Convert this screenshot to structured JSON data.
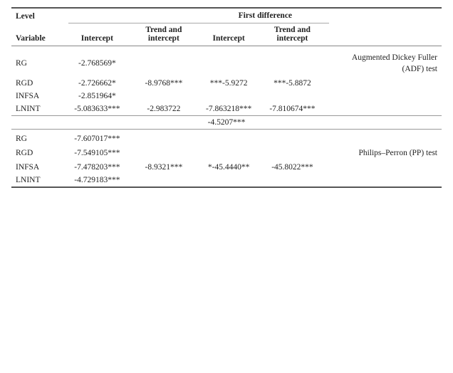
{
  "table": {
    "col_headers": {
      "level": "Level",
      "first_difference": "First difference",
      "variable": "Variable",
      "intercept1": "Intercept",
      "trend_intercept1": "Trend and intercept",
      "intercept2": "Intercept",
      "trend_intercept2": "Trend and intercept"
    },
    "adf_rows": [
      {
        "variable": "RG",
        "intercept": "-2.768569*",
        "trend": "",
        "fd_intercept": "",
        "fd_trend": "",
        "note": "Augmented Dickey Fuller (ADF) test"
      },
      {
        "variable": "RGD",
        "intercept": "-2.726662*",
        "trend": "-8.9768***",
        "fd_intercept": "***-5.9272",
        "fd_trend": "***-5.8872",
        "note": ""
      },
      {
        "variable": "INFSA",
        "intercept": "-2.851964*",
        "trend": "",
        "fd_intercept": "",
        "fd_trend": "",
        "note": ""
      },
      {
        "variable": "LNINT",
        "intercept": "-5.083633***",
        "trend": "-2.983722",
        "fd_intercept": "-7.863218***",
        "fd_trend": "-7.810674***",
        "note": ""
      }
    ],
    "adf_divider": "-4.5207***",
    "pp_rows": [
      {
        "variable": "RG",
        "intercept": "-7.607017***",
        "trend": "",
        "fd_intercept": "",
        "fd_trend": "",
        "note": ""
      },
      {
        "variable": "RGD",
        "intercept": "-7.549105***",
        "trend": "",
        "fd_intercept": "",
        "fd_trend": "",
        "note": "Philips–Perron (PP) test"
      },
      {
        "variable": "INFSA",
        "intercept": "-7.478203***",
        "trend": "-8.9321***",
        "fd_intercept": "*-45.4440**",
        "fd_trend": "-45.8022***",
        "note": ""
      },
      {
        "variable": "LNINT",
        "intercept": "-4.729183***",
        "trend": "",
        "fd_intercept": "",
        "fd_trend": "",
        "note": ""
      }
    ]
  }
}
